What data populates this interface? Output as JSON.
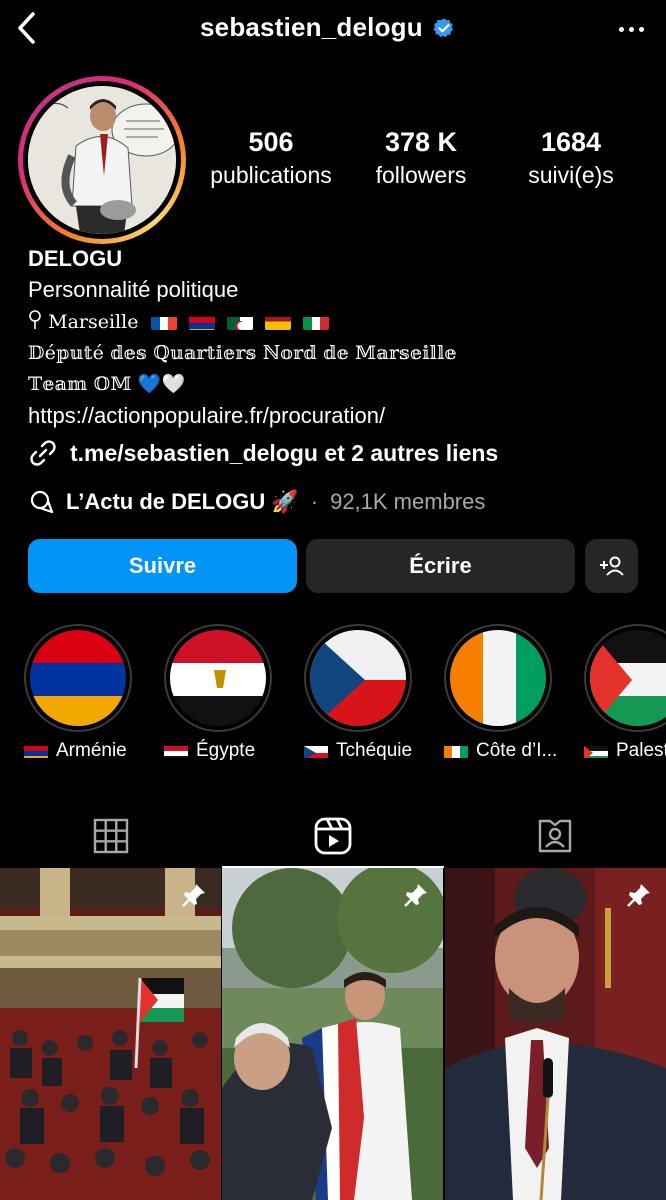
{
  "header": {
    "username": "sebastien_delogu",
    "verified_icon": "verified-badge-icon",
    "back_icon": "chevron-left-icon",
    "more_icon": "more-horizontal-icon"
  },
  "profile": {
    "avatar": "avatar",
    "stats": [
      {
        "value": "506",
        "label": "publications"
      },
      {
        "value": "378 K",
        "label": "followers"
      },
      {
        "value": "1684",
        "label": "suivi(e)s"
      }
    ],
    "display_name": "DELOGU",
    "category": "Personnalité politique",
    "location": "Marseille",
    "location_icon": "location-pin-icon",
    "bio_line1": "𝔻é𝕡𝕦𝕥é 𝕕𝕖𝕤 ℚ𝕦𝕒𝕣𝕥𝕚𝕖𝕣𝕤 ℕ𝕠𝕣𝕕 𝕕𝕖 𝕄𝕒𝕣𝕤𝕖𝕚𝕝𝕝𝕖",
    "bio_line2": "𝕋𝕖𝕒𝕞 𝕆𝕄 💙🤍",
    "website": "https://actionpopulaire.fr/procuration/",
    "links_text": "t.me/sebastien_delogu et 2 autres liens",
    "links_icon": "link-icon",
    "channel_icon": "broadcast-channel-icon",
    "channel_name": "L’Actu de DELOGU 🚀",
    "channel_separator": "·",
    "channel_members": "92,1K membres"
  },
  "actions": {
    "follow": "Suivre",
    "message": "Écrire",
    "add_user_icon": "add-user-icon"
  },
  "highlights": [
    {
      "label": "Arménie",
      "flag": "armenia"
    },
    {
      "label": "Égypte",
      "flag": "egypt"
    },
    {
      "label": "Tchéquie",
      "flag": "czechia"
    },
    {
      "label": "Côte d’I...",
      "flag": "ivory-coast"
    },
    {
      "label": "Palest",
      "flag": "palestine"
    }
  ],
  "tabs": [
    {
      "icon": "grid-icon",
      "active": false
    },
    {
      "icon": "reels-icon",
      "active": true
    },
    {
      "icon": "tagged-icon",
      "active": false
    }
  ],
  "grid": [
    {
      "name": "assembly-photo",
      "pinned": true
    },
    {
      "name": "sash-ceremony-photo",
      "pinned": true
    },
    {
      "name": "speaker-at-microphone-photo",
      "pinned": true
    }
  ],
  "colors": {
    "background": "#000000",
    "primary": "#0095f6",
    "secondary_button": "#262626",
    "muted_text": "#a8a8a8"
  }
}
